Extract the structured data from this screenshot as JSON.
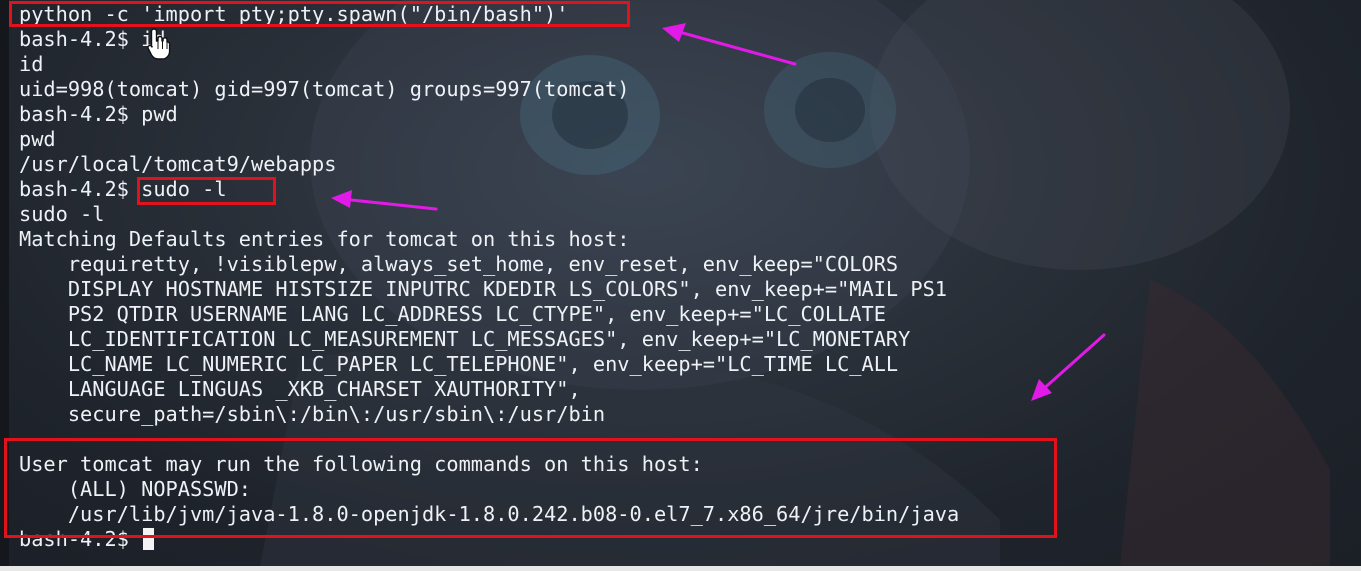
{
  "terminal": {
    "lines": [
      "python -c 'import pty;pty.spawn(\"/bin/bash\")'",
      "bash-4.2$ id",
      "id",
      "uid=998(tomcat) gid=997(tomcat) groups=997(tomcat)",
      "bash-4.2$ pwd",
      "pwd",
      "/usr/local/tomcat9/webapps",
      "bash-4.2$ sudo -l",
      "sudo -l",
      "Matching Defaults entries for tomcat on this host:",
      "    requiretty, !visiblepw, always_set_home, env_reset, env_keep=\"COLORS",
      "    DISPLAY HOSTNAME HISTSIZE INPUTRC KDEDIR LS_COLORS\", env_keep+=\"MAIL PS1",
      "    PS2 QTDIR USERNAME LANG LC_ADDRESS LC_CTYPE\", env_keep+=\"LC_COLLATE",
      "    LC_IDENTIFICATION LC_MEASUREMENT LC_MESSAGES\", env_keep+=\"LC_MONETARY",
      "    LC_NAME LC_NUMERIC LC_PAPER LC_TELEPHONE\", env_keep+=\"LC_TIME LC_ALL",
      "    LANGUAGE LINGUAS _XKB_CHARSET XAUTHORITY\",",
      "    secure_path=/sbin\\:/bin\\:/usr/sbin\\:/usr/bin",
      "",
      "User tomcat may run the following commands on this host:",
      "    (ALL) NOPASSWD:",
      "    /usr/lib/jvm/java-1.8.0-openjdk-1.8.0.242.b08-0.el7_7.x86_64/jre/bin/java",
      "bash-4.2$ "
    ]
  },
  "colors": {
    "background": "#262b33",
    "text": "#eef1f5",
    "highlight_box": "#e2111c",
    "arrow": "#e21ae8"
  },
  "icons": [
    "mouse-pointer-hand-icon",
    "arrow-icon"
  ]
}
